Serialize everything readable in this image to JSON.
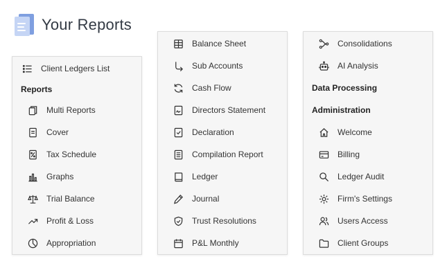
{
  "header": {
    "title": "Your Reports",
    "logo_icon": "reports-logo-icon"
  },
  "panel1": {
    "client_ledgers": {
      "label": "Client Ledgers List",
      "icon": "list-icon"
    },
    "reports_heading": "Reports",
    "items": [
      {
        "label": "Multi Reports",
        "icon": "copy-icon"
      },
      {
        "label": "Cover",
        "icon": "document-icon"
      },
      {
        "label": "Tax Schedule",
        "icon": "percent-document-icon"
      },
      {
        "label": "Graphs",
        "icon": "bar-chart-icon"
      },
      {
        "label": "Trial Balance",
        "icon": "scale-icon"
      },
      {
        "label": "Profit & Loss",
        "icon": "trend-up-icon"
      },
      {
        "label": "Appropriation",
        "icon": "pie-clock-icon"
      }
    ]
  },
  "panel2": {
    "items": [
      {
        "label": "Balance Sheet",
        "icon": "table-icon"
      },
      {
        "label": "Sub Accounts",
        "icon": "sub-arrow-icon"
      },
      {
        "label": "Cash Flow",
        "icon": "refresh-icon"
      },
      {
        "label": "Directors Statement",
        "icon": "signature-document-icon"
      },
      {
        "label": "Declaration",
        "icon": "check-document-icon"
      },
      {
        "label": "Compilation Report",
        "icon": "lines-document-icon"
      },
      {
        "label": "Ledger",
        "icon": "book-icon"
      },
      {
        "label": "Journal",
        "icon": "pencil-icon"
      },
      {
        "label": "Trust Resolutions",
        "icon": "shield-check-icon"
      },
      {
        "label": "P&L Monthly",
        "icon": "calendar-icon"
      }
    ]
  },
  "panel3": {
    "top_items": [
      {
        "label": "Consolidations",
        "icon": "merge-icon"
      },
      {
        "label": "AI Analysis",
        "icon": "robot-icon"
      }
    ],
    "data_processing_heading": "Data Processing",
    "administration_heading": "Administration",
    "admin_items": [
      {
        "label": "Welcome",
        "icon": "home-icon"
      },
      {
        "label": "Billing",
        "icon": "credit-card-icon"
      },
      {
        "label": "Ledger Audit",
        "icon": "search-icon"
      },
      {
        "label": "Firm's Settings",
        "icon": "gear-icon"
      },
      {
        "label": "Users Access",
        "icon": "users-icon"
      },
      {
        "label": "Client Groups",
        "icon": "folder-icon"
      }
    ]
  }
}
